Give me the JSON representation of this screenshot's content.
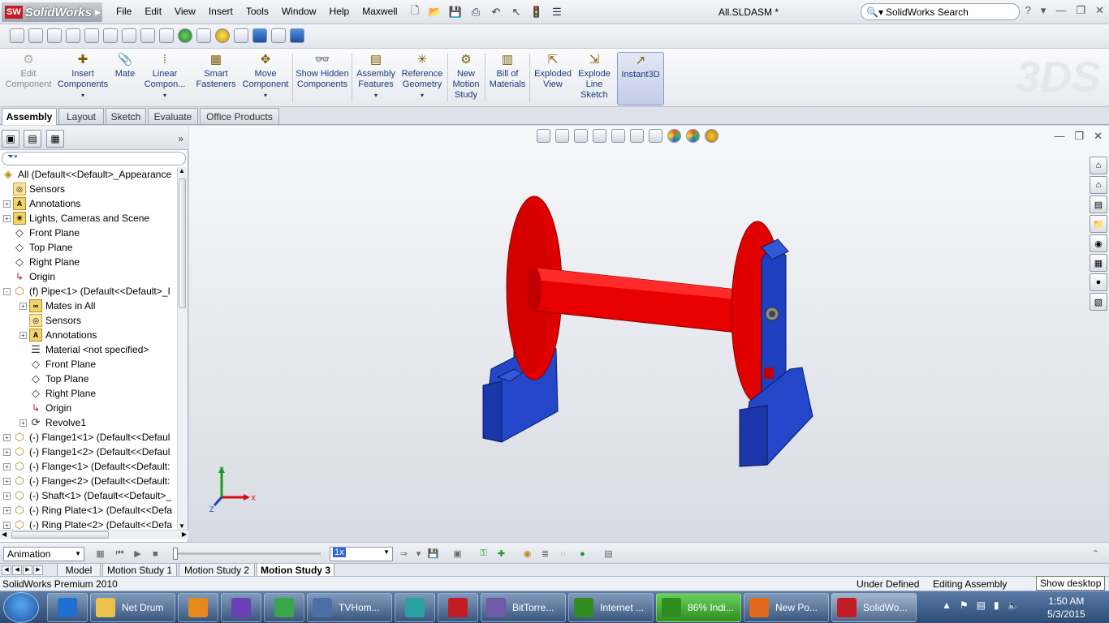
{
  "app": {
    "logo_text": "SolidWorks",
    "logo_badge": "SW",
    "document_title": "All.SLDASM *",
    "search_placeholder": "SolidWorks Search"
  },
  "menu": [
    "File",
    "Edit",
    "View",
    "Insert",
    "Tools",
    "Window",
    "Help",
    "Maxwell"
  ],
  "commands": [
    {
      "label": "Edit Component",
      "icon": "edit-component-icon",
      "enabled": false
    },
    {
      "label": "Insert Components",
      "icon": "insert-components-icon",
      "enabled": true
    },
    {
      "label": "Mate",
      "icon": "mate-icon",
      "enabled": true
    },
    {
      "label": "Linear Compon...",
      "icon": "linear-pattern-icon",
      "enabled": true
    },
    {
      "label": "Smart Fasteners",
      "icon": "smart-fasteners-icon",
      "enabled": true
    },
    {
      "label": "Move Component",
      "icon": "move-component-icon",
      "enabled": true
    },
    {
      "label": "Show Hidden Components",
      "icon": "show-hidden-icon",
      "enabled": true
    },
    {
      "label": "Assembly Features",
      "icon": "assembly-features-icon",
      "enabled": true
    },
    {
      "label": "Reference Geometry",
      "icon": "reference-geometry-icon",
      "enabled": true
    },
    {
      "label": "New Motion Study",
      "icon": "motion-study-icon",
      "enabled": true
    },
    {
      "label": "Bill of Materials",
      "icon": "bom-icon",
      "enabled": true
    },
    {
      "label": "Exploded View",
      "icon": "exploded-view-icon",
      "enabled": true
    },
    {
      "label": "Explode Line Sketch",
      "icon": "explode-line-icon",
      "enabled": true
    },
    {
      "label": "Instant3D",
      "icon": "instant3d-icon",
      "enabled": true,
      "active": true
    }
  ],
  "tabs": [
    "Assembly",
    "Layout",
    "Sketch",
    "Evaluate",
    "Office Products"
  ],
  "tree": {
    "root": "All  (Default<<Default>_Appearance",
    "items": [
      {
        "label": "Sensors",
        "level": 1,
        "icon": "sensor-icon",
        "expand": ""
      },
      {
        "label": "Annotations",
        "level": 1,
        "icon": "annotations-icon",
        "expand": "+"
      },
      {
        "label": "Lights, Cameras and Scene",
        "level": 1,
        "icon": "lights-icon",
        "expand": "+"
      },
      {
        "label": "Front Plane",
        "level": 1,
        "icon": "plane-icon",
        "expand": ""
      },
      {
        "label": "Top Plane",
        "level": 1,
        "icon": "plane-icon",
        "expand": ""
      },
      {
        "label": "Right Plane",
        "level": 1,
        "icon": "plane-icon",
        "expand": ""
      },
      {
        "label": "Origin",
        "level": 1,
        "icon": "origin-icon",
        "expand": ""
      },
      {
        "label": "(f) Pipe<1> (Default<<Default>_I",
        "level": 1,
        "icon": "part-icon",
        "expand": "-"
      },
      {
        "label": "Mates in All",
        "level": 2,
        "icon": "mates-icon",
        "expand": "+"
      },
      {
        "label": "Sensors",
        "level": 2,
        "icon": "sensor-icon",
        "expand": ""
      },
      {
        "label": "Annotations",
        "level": 2,
        "icon": "annotations-icon",
        "expand": "+"
      },
      {
        "label": "Material <not specified>",
        "level": 2,
        "icon": "material-icon",
        "expand": ""
      },
      {
        "label": "Front Plane",
        "level": 2,
        "icon": "plane-icon",
        "expand": ""
      },
      {
        "label": "Top Plane",
        "level": 2,
        "icon": "plane-icon",
        "expand": ""
      },
      {
        "label": "Right Plane",
        "level": 2,
        "icon": "plane-icon",
        "expand": ""
      },
      {
        "label": "Origin",
        "level": 2,
        "icon": "origin-icon",
        "expand": ""
      },
      {
        "label": "Revolve1",
        "level": 2,
        "icon": "revolve-icon",
        "expand": "+"
      },
      {
        "label": "(-) Flange1<1> (Default<<Defaul",
        "level": 1,
        "icon": "part-icon",
        "expand": "+"
      },
      {
        "label": "(-) Flange1<2> (Default<<Defaul",
        "level": 1,
        "icon": "part-icon",
        "expand": "+"
      },
      {
        "label": "(-) Flange<1> (Default<<Default:",
        "level": 1,
        "icon": "part-icon",
        "expand": "+"
      },
      {
        "label": "(-) Flange<2> (Default<<Default:",
        "level": 1,
        "icon": "part-icon",
        "expand": "+"
      },
      {
        "label": "(-) Shaft<1> (Default<<Default>_",
        "level": 1,
        "icon": "part-icon",
        "expand": "+"
      },
      {
        "label": "(-) Ring Plate<1> (Default<<Defa",
        "level": 1,
        "icon": "part-icon",
        "expand": "+"
      },
      {
        "label": "(-) Ring Plate<2> (Default<<Defa",
        "level": 1,
        "icon": "part-icon",
        "expand": "+"
      }
    ]
  },
  "triad": {
    "x": "X",
    "y": "Y",
    "z": "Z"
  },
  "motion": {
    "mode": "Animation",
    "speed": "1x",
    "study_tabs": [
      "Model",
      "Motion Study 1",
      "Motion Study 2",
      "Motion Study 3"
    ],
    "active_tab": "Motion Study 3"
  },
  "status": {
    "product": "SolidWorks Premium 2010",
    "state": "Under Defined",
    "mode": "Editing Assembly",
    "tooltip": "Show desktop"
  },
  "taskbar": {
    "items": [
      {
        "label": "",
        "icon": "ie-icon",
        "color": "#1f6fd1"
      },
      {
        "label": "Net Drum",
        "icon": "folder-icon",
        "color": "#e9c14b"
      },
      {
        "label": "",
        "icon": "media-icon",
        "color": "#e68a1e"
      },
      {
        "label": "",
        "icon": "vs-icon",
        "color": "#6a3fb3"
      },
      {
        "label": "",
        "icon": "chrome-icon",
        "color": "#3aa54a"
      },
      {
        "label": "TVHom...",
        "icon": "tv-icon",
        "color": "#4c6fa8"
      },
      {
        "label": "",
        "icon": "autocad-icon",
        "color": "#2aa1a1"
      },
      {
        "label": "",
        "icon": "solidworks-icon",
        "color": "#c21d24"
      },
      {
        "label": "BitTorre...",
        "icon": "bittorrent-icon",
        "color": "#6d5aa8"
      },
      {
        "label": "Internet ...",
        "icon": "idm-icon",
        "color": "#2f8d22"
      },
      {
        "label": "86% Indi...",
        "icon": "download-icon",
        "color": "#2f8d22"
      },
      {
        "label": "New Po...",
        "icon": "firefox-icon",
        "color": "#e06a1a"
      },
      {
        "label": "SolidWo...",
        "icon": "solidworks-icon",
        "color": "#c21d24"
      }
    ],
    "time": "1:50 AM",
    "date": "5/3/2015"
  },
  "colors": {
    "part_red": "#e00000",
    "support_blue": "#1d3fc0",
    "accent": "#3369d6"
  }
}
